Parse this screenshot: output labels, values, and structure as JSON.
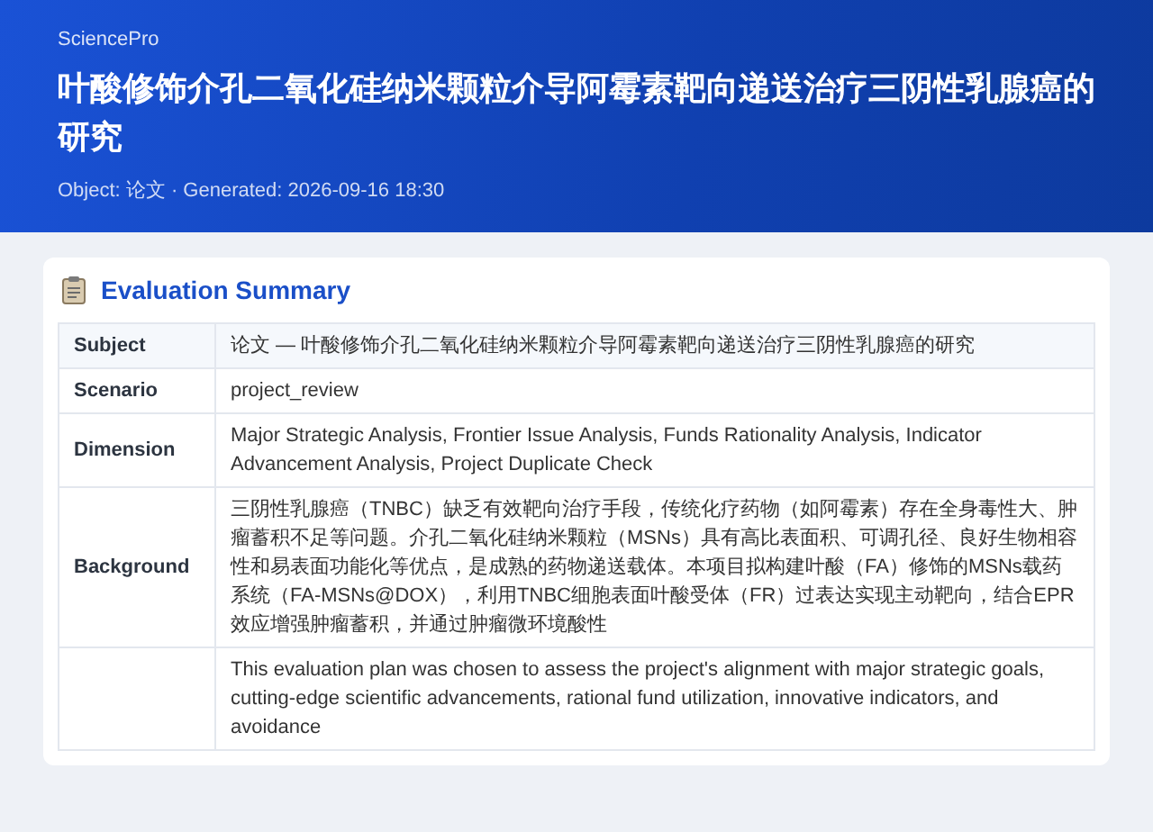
{
  "header": {
    "brand": "SciencePro",
    "title": "叶酸修饰介孔二氧化硅纳米颗粒介导阿霉素靶向递送治疗三阴性乳腺癌的研究",
    "meta": "Object: 论文 · Generated: 2026-09-16 18:30"
  },
  "summary": {
    "title": "Evaluation Summary",
    "rows": [
      {
        "label": "Subject",
        "value": "论文 — 叶酸修饰介孔二氧化硅纳米颗粒介导阿霉素靶向递送治疗三阴性乳腺癌的研究"
      },
      {
        "label": "Scenario",
        "value": "project_review"
      },
      {
        "label": "Dimension",
        "value": "Major Strategic Analysis, Frontier Issue Analysis, Funds Rationality Analysis, Indicator Advancement Analysis, Project Duplicate Check"
      },
      {
        "label": "Background",
        "value": "三阴性乳腺癌（TNBC）缺乏有效靶向治疗手段，传统化疗药物（如阿霉素）存在全身毒性大、肿瘤蓄积不足等问题。介孔二氧化硅纳米颗粒（MSNs）具有高比表面积、可调孔径、良好生物相容性和易表面功能化等优点，是成熟的药物递送载体。本项目拟构建叶酸（FA）修饰的MSNs载药系统（FA-MSNs@DOX），利用TNBC细胞表面叶酸受体（FR）过表达实现主动靶向，结合EPR效应增强肿瘤蓄积，并通过肿瘤微环境酸性"
      },
      {
        "value": "This evaluation plan was chosen to assess the project's alignment with major strategic goals, cutting-edge scientific advancements, rational fund utilization, innovative indicators, and avoidance"
      }
    ]
  }
}
